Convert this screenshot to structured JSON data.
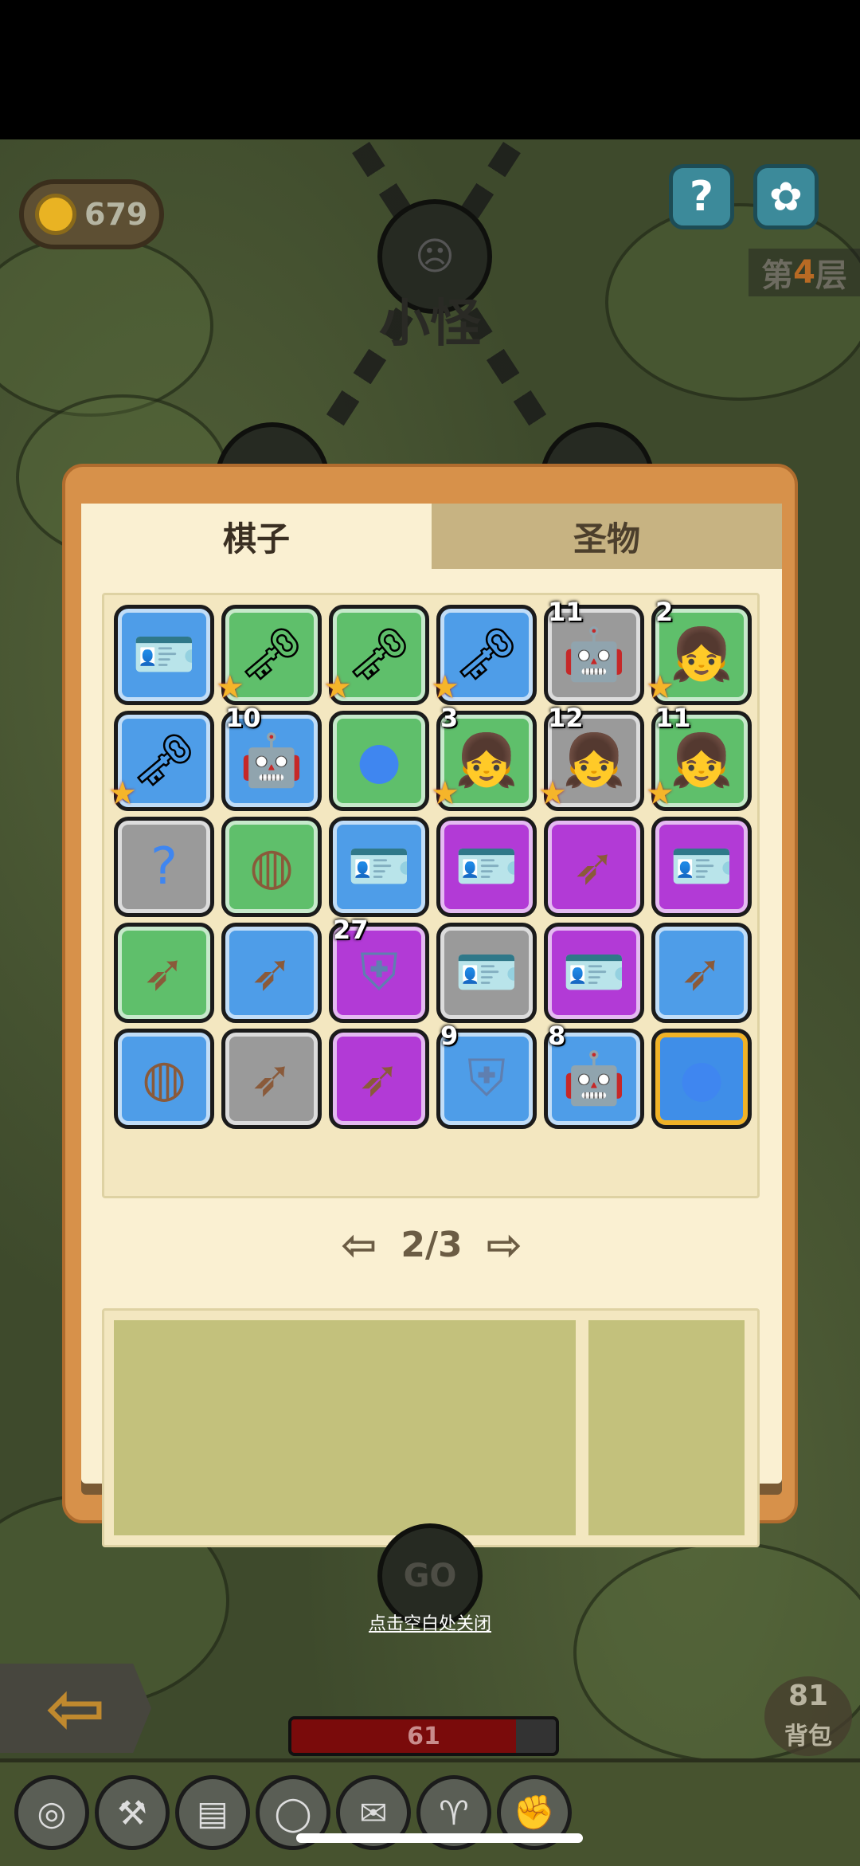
{
  "hud": {
    "coins": "679",
    "help_label": "?",
    "settings_icon": "gear-icon",
    "floor_prefix": "第",
    "floor_number": "4",
    "floor_suffix": "层"
  },
  "map": {
    "current_node_title": "小怪",
    "go_label": "GO",
    "close_hint": "点击空白处关闭"
  },
  "panel": {
    "tabs": [
      {
        "label": "棋子",
        "active": true
      },
      {
        "label": "圣物",
        "active": false
      }
    ],
    "pager": {
      "text": "2/3"
    }
  },
  "pieces": [
    {
      "icon": "nurse-card-icon",
      "bg": "blue",
      "badge": "",
      "star": false
    },
    {
      "icon": "viking-key-icon",
      "bg": "green",
      "badge": "",
      "star": true
    },
    {
      "icon": "viking-key-icon",
      "bg": "green",
      "badge": "",
      "star": true
    },
    {
      "icon": "viking-key-icon",
      "bg": "blue",
      "badge": "",
      "star": true
    },
    {
      "icon": "robot-dog-icon",
      "bg": "gray",
      "badge": "11",
      "star": false
    },
    {
      "icon": "ninja-girl-icon",
      "bg": "green",
      "badge": "2",
      "star": true
    },
    {
      "icon": "viking-key-icon",
      "bg": "blue",
      "badge": "",
      "star": true
    },
    {
      "icon": "robot-dog-icon",
      "bg": "blue",
      "badge": "10",
      "star": false
    },
    {
      "icon": "blue-slime-icon",
      "bg": "green",
      "badge": "",
      "star": false
    },
    {
      "icon": "ninja-girl-icon",
      "bg": "green",
      "badge": "3",
      "star": true
    },
    {
      "icon": "ninja-girl-icon",
      "bg": "gray",
      "badge": "12",
      "star": true
    },
    {
      "icon": "ninja-girl-icon",
      "bg": "green",
      "badge": "11",
      "star": true
    },
    {
      "icon": "question-mark-icon",
      "bg": "gray",
      "badge": "",
      "star": false
    },
    {
      "icon": "nest-icon",
      "bg": "green",
      "badge": "",
      "star": false
    },
    {
      "icon": "nurse-card-icon",
      "bg": "blue",
      "badge": "",
      "star": false
    },
    {
      "icon": "nurse-card-icon",
      "bg": "purple",
      "badge": "",
      "star": false
    },
    {
      "icon": "spear-icon",
      "bg": "purple",
      "badge": "",
      "star": false
    },
    {
      "icon": "nurse-card-icon",
      "bg": "purple",
      "badge": "",
      "star": false
    },
    {
      "icon": "spear-icon",
      "bg": "green",
      "badge": "",
      "star": false
    },
    {
      "icon": "spear-icon",
      "bg": "blue",
      "badge": "",
      "star": false
    },
    {
      "icon": "shield-icon",
      "bg": "purple",
      "badge": "27",
      "star": false
    },
    {
      "icon": "nurse-card-icon",
      "bg": "gray",
      "badge": "",
      "star": false
    },
    {
      "icon": "nurse-card-icon",
      "bg": "purple",
      "badge": "",
      "star": false
    },
    {
      "icon": "spear-icon",
      "bg": "blue",
      "badge": "",
      "star": false
    },
    {
      "icon": "nest-icon",
      "bg": "blue",
      "badge": "",
      "star": false
    },
    {
      "icon": "spear-icon",
      "bg": "gray",
      "badge": "",
      "star": false
    },
    {
      "icon": "spear-icon",
      "bg": "purple",
      "badge": "",
      "star": false
    },
    {
      "icon": "shield-icon",
      "bg": "blue",
      "badge": "9",
      "star": false
    },
    {
      "icon": "robot-dog-icon",
      "bg": "blue",
      "badge": "8",
      "star": false
    },
    {
      "icon": "blue-slime-icon",
      "bg": "gold",
      "badge": "",
      "star": false
    }
  ],
  "status": {
    "hp": "61",
    "hp_fraction": 0.85,
    "bag_count": "81",
    "bag_label": "背包"
  },
  "equipment": [
    {
      "icon": "eggs-icon"
    },
    {
      "icon": "hammer-icon"
    },
    {
      "icon": "book-icon"
    },
    {
      "icon": "ring-icon"
    },
    {
      "icon": "scroll-icon"
    },
    {
      "icon": "goat-icon"
    },
    {
      "icon": "boxing-glove-icon"
    }
  ],
  "colors": {
    "blue": "#4e9de8",
    "green": "#5fbf6b",
    "gray": "#9a9a9a",
    "purple": "#b23ad6",
    "gold": "#f0b227",
    "panel_orange": "#d7914a"
  }
}
